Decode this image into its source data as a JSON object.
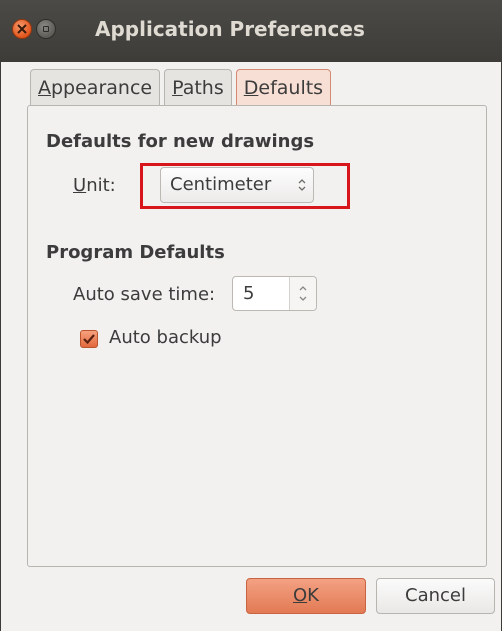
{
  "window": {
    "title": "Application Preferences",
    "accent_color": "#e27a54",
    "highlight_color": "#d7151a"
  },
  "tabs": [
    {
      "label_first": "A",
      "label_rest": "ppearance",
      "active": false
    },
    {
      "label_first": "P",
      "label_rest": "aths",
      "active": false
    },
    {
      "label_first": "D",
      "label_rest": "efaults",
      "active": true
    }
  ],
  "new_drawings": {
    "heading": "Defaults for new drawings",
    "unit_label_first": "U",
    "unit_label_rest": "nit:",
    "unit_value": "Centimeter"
  },
  "program": {
    "heading": "Program Defaults",
    "auto_save_label": "Auto save time:",
    "auto_save_value": "5",
    "auto_backup_label": "Auto backup",
    "auto_backup_checked": true
  },
  "buttons": {
    "ok_first": "O",
    "ok_rest": "K",
    "cancel": "Cancel"
  }
}
